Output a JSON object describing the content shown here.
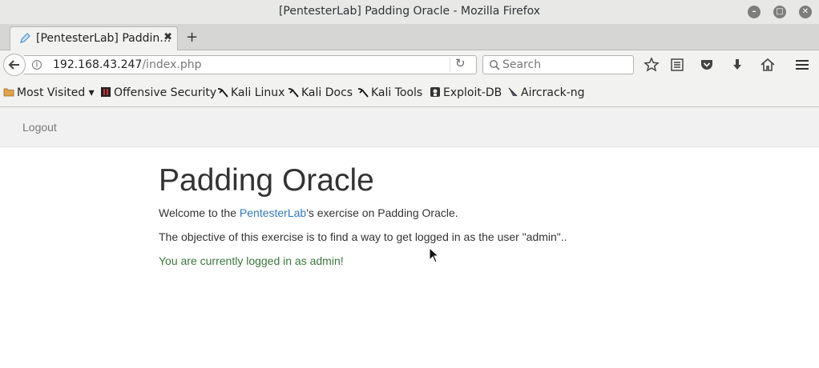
{
  "window": {
    "title": "[PentesterLab] Padding Oracle - Mozilla Firefox"
  },
  "tab": {
    "label": "[PentesterLab] Paddin…",
    "close": "✖"
  },
  "newtab": {
    "label": "+"
  },
  "urlbar": {
    "host": "192.168.43.247",
    "path": "/index.php"
  },
  "search": {
    "placeholder": "Search"
  },
  "bookmarks": {
    "most_visited": "Most Visited ▾",
    "items": [
      "Offensive Security",
      "Kali Linux",
      "Kali Docs",
      "Kali Tools",
      "Exploit-DB",
      "Aircrack-ng"
    ]
  },
  "nav": {
    "logout": "Logout"
  },
  "content": {
    "heading": "Padding Oracle",
    "intro_prefix": "Welcome to the ",
    "intro_link": "PentesterLab",
    "intro_suffix": "'s exercise on Padding Oracle.",
    "objective": "The objective of this exercise is to find a way to get logged in as the user \"admin\"..",
    "status": "You are currently logged in as admin!"
  },
  "colors": {
    "link": "#337ab7",
    "success": "#3c763d",
    "accent_icon": "#4a90d9"
  }
}
